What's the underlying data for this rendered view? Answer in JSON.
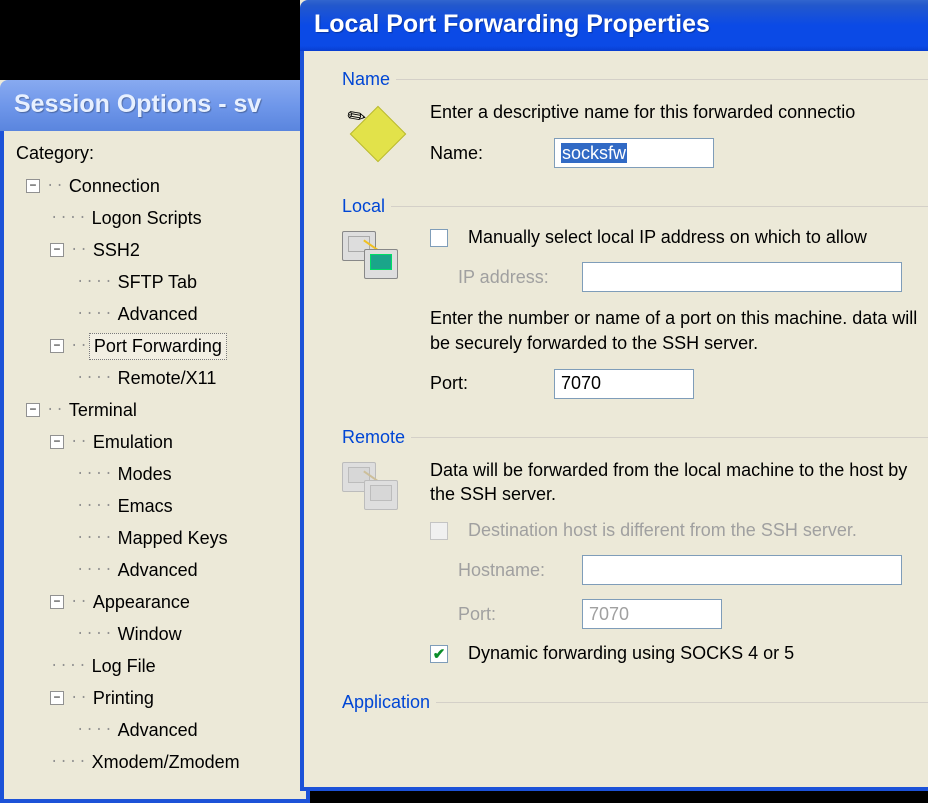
{
  "session_window": {
    "title": "Session Options - sv",
    "category_label": "Category:",
    "tree": {
      "connection": "Connection",
      "logon_scripts": "Logon Scripts",
      "ssh2": "SSH2",
      "sftp_tab": "SFTP Tab",
      "ssh2_advanced": "Advanced",
      "port_forwarding": "Port Forwarding",
      "remote_x11": "Remote/X11",
      "terminal": "Terminal",
      "emulation": "Emulation",
      "modes": "Modes",
      "emacs": "Emacs",
      "mapped_keys": "Mapped Keys",
      "emu_advanced": "Advanced",
      "appearance": "Appearance",
      "window": "Window",
      "log_file": "Log File",
      "printing": "Printing",
      "print_advanced": "Advanced",
      "xmodem": "Xmodem/Zmodem"
    }
  },
  "props_window": {
    "title": "Local Port Forwarding Properties",
    "sections": {
      "name": {
        "legend": "Name",
        "help": "Enter a descriptive name for this forwarded connectio",
        "label": "Name:",
        "value": "socksfw"
      },
      "local": {
        "legend": "Local",
        "checkbox_label": "Manually select local IP address on which to allow",
        "ip_label": "IP address:",
        "ip_value": "",
        "help": "Enter the number or name of a port on this machine. data will be securely forwarded to the SSH server.",
        "port_label": "Port:",
        "port_value": "7070"
      },
      "remote": {
        "legend": "Remote",
        "help": "Data will be forwarded from the local machine to the host by the SSH server.",
        "dest_checkbox_label": "Destination host is different from the SSH server.",
        "host_label": "Hostname:",
        "host_value": "",
        "port_label": "Port:",
        "port_value": "7070",
        "dynamic_checkbox_label": "Dynamic forwarding using SOCKS 4 or 5"
      },
      "application": {
        "legend": "Application"
      }
    }
  }
}
